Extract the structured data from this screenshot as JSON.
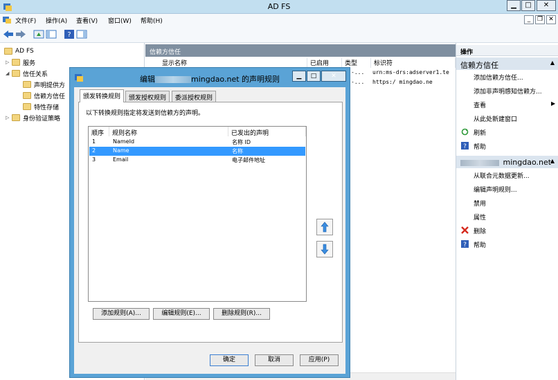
{
  "window": {
    "title": "AD FS"
  },
  "menu": [
    "文件(F)",
    "操作(A)",
    "查看(V)",
    "窗口(W)",
    "帮助(H)"
  ],
  "tree": {
    "root": "AD FS",
    "items": [
      {
        "label": "服务",
        "indent": 1,
        "twisty": "▷"
      },
      {
        "label": "信任关系",
        "indent": 1,
        "twisty": "◢"
      },
      {
        "label": "声明提供方",
        "indent": 2,
        "twisty": ""
      },
      {
        "label": "信赖方信任",
        "indent": 2,
        "twisty": ""
      },
      {
        "label": "特性存储",
        "indent": 2,
        "twisty": ""
      },
      {
        "label": "身份验证策略",
        "indent": 1,
        "twisty": "▷"
      }
    ]
  },
  "middle": {
    "header": "信赖方信任",
    "columns": [
      "显示名称",
      "已启用",
      "类型",
      "标识符"
    ],
    "rows": [
      {
        "type": "-...",
        "identifier": "urn:ms-drs:adserver1.te"
      },
      {
        "type": "-...",
        "identifier": "https:/          mingdao.ne"
      }
    ]
  },
  "actions": {
    "title": "操作",
    "section1": {
      "label": "信赖方信任",
      "items": [
        {
          "label": "添加信赖方信任...",
          "icon": ""
        },
        {
          "label": "添加非声明感知信赖方...",
          "icon": ""
        },
        {
          "label": "查看",
          "icon": "",
          "submenu": "▶"
        },
        {
          "label": "从此处新建窗口",
          "icon": ""
        },
        {
          "label": "刷新",
          "icon": "refresh-icon"
        },
        {
          "label": "帮助",
          "icon": "help-icon"
        }
      ]
    },
    "section2": {
      "label": "mingdao.net",
      "items": [
        {
          "label": "从联合元数据更新...",
          "icon": ""
        },
        {
          "label": "编辑声明规则...",
          "icon": ""
        },
        {
          "label": "禁用",
          "icon": ""
        },
        {
          "label": "属性",
          "icon": ""
        },
        {
          "label": "删除",
          "icon": "delete-icon"
        },
        {
          "label": "帮助",
          "icon": "help-icon"
        }
      ]
    }
  },
  "dialog": {
    "title_prefix": "编辑",
    "title_suffix": "mingdao.net 的声明规则",
    "tabs": [
      "颁发转换规则",
      "颁发授权规则",
      "委派授权规则"
    ],
    "active_tab": 0,
    "instruction": "以下转换规则指定将发送到信赖方的声明。",
    "table": {
      "columns": [
        "顺序",
        "规则名称",
        "已发出的声明"
      ],
      "rows": [
        {
          "order": "1",
          "name": "NameId",
          "claim": "名称 ID",
          "selected": false
        },
        {
          "order": "2",
          "name": "Name",
          "claim": "名称",
          "selected": true
        },
        {
          "order": "3",
          "name": "Email",
          "claim": "电子邮件地址",
          "selected": false
        }
      ]
    },
    "buttons": {
      "add": "添加规则(A)...",
      "edit": "编辑规则(E)...",
      "delete": "删除规则(R)...",
      "ok": "确定",
      "cancel": "取消",
      "apply": "应用(P)"
    }
  },
  "colors": {
    "accent": "#3399ff",
    "dialog_frame": "#5aa3d6",
    "header": "#7f8fa0"
  }
}
